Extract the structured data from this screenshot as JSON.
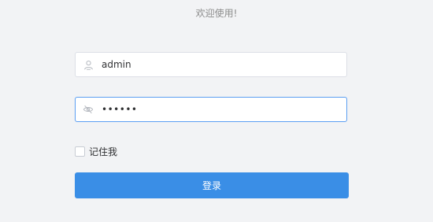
{
  "header": {
    "welcome_text": "欢迎使用!"
  },
  "form": {
    "username": {
      "value": "admin",
      "icon": "user-icon"
    },
    "password": {
      "value": "••••••",
      "icon": "eye-off-icon",
      "focused": true
    },
    "remember_me": {
      "label": "记住我",
      "checked": false
    },
    "submit_label": "登录"
  },
  "colors": {
    "background": "#f2f3f5",
    "primary": "#3a8ee6",
    "focus_border": "#5b9ef2",
    "text": "#303133",
    "muted_text": "#8c8c8c"
  }
}
